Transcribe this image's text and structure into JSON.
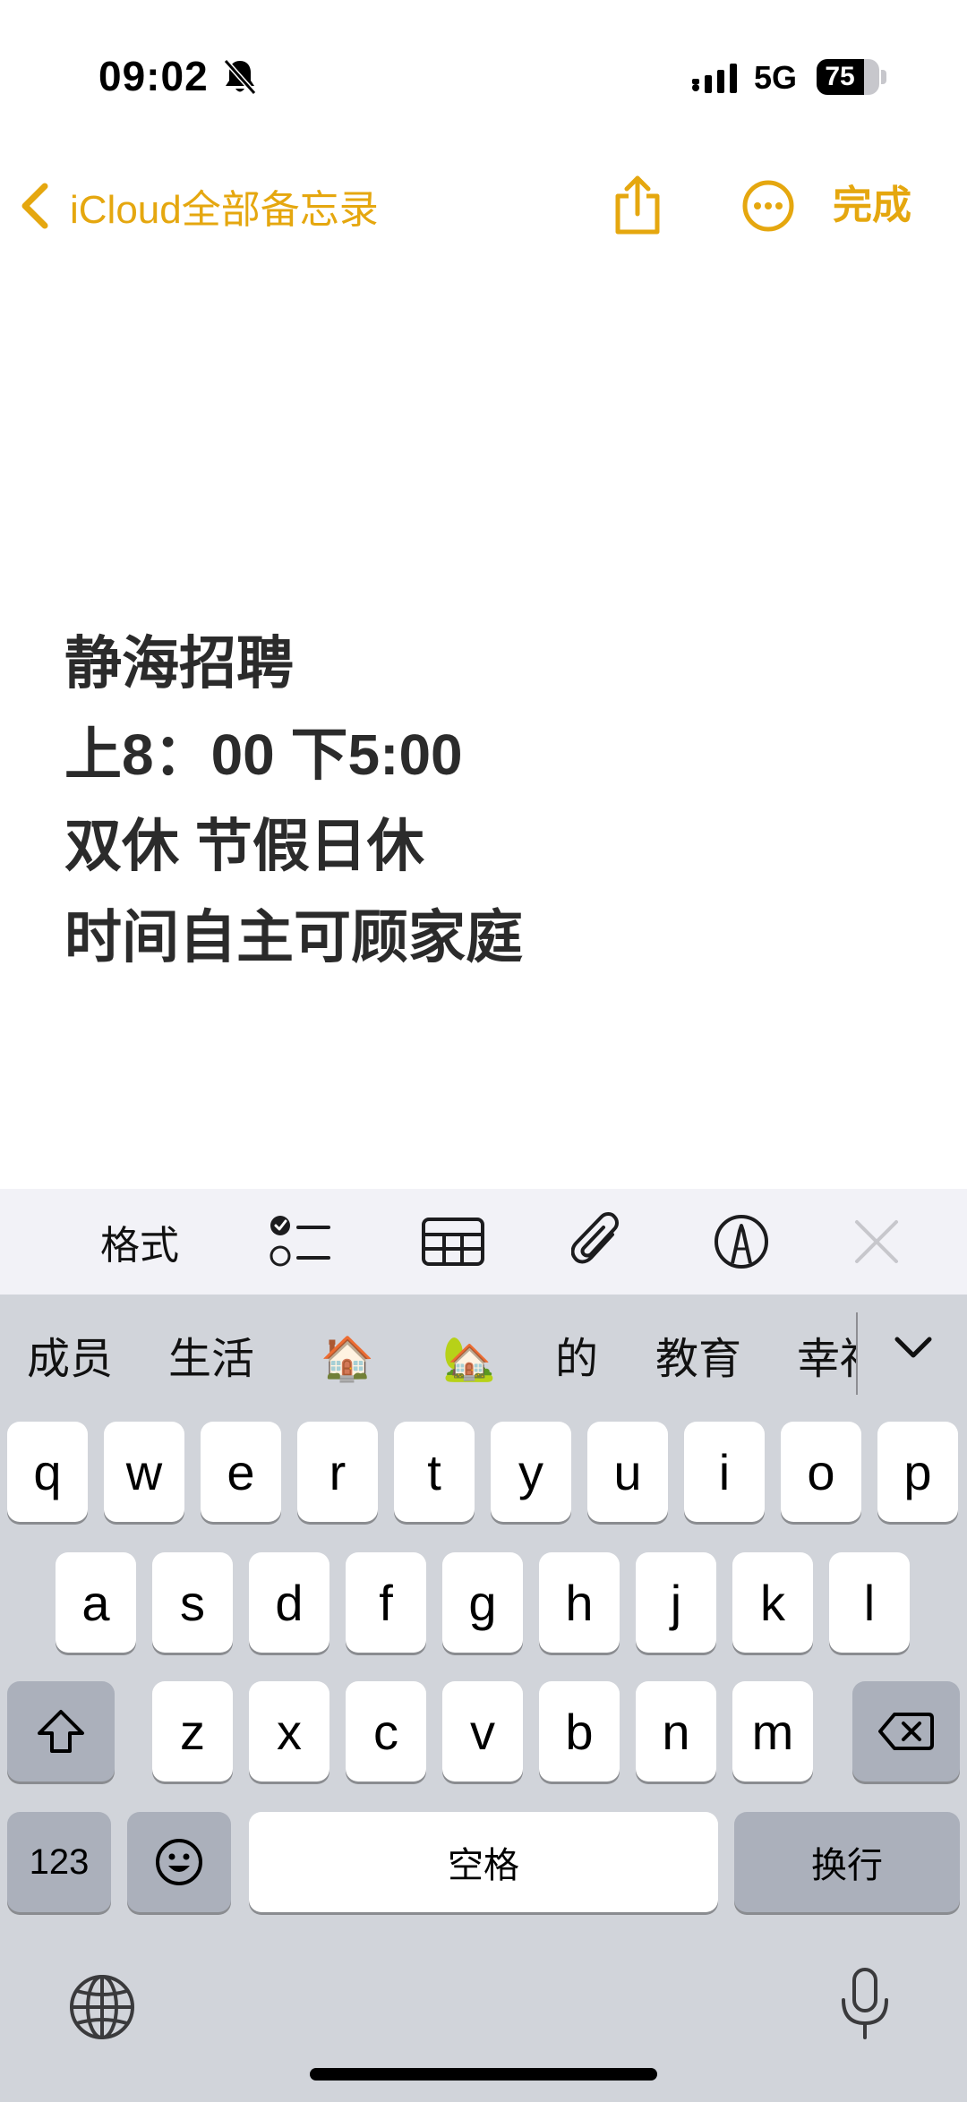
{
  "status_bar": {
    "time": "09:02",
    "network": "5G",
    "battery_level": "75",
    "battery_fraction": 0.75
  },
  "nav": {
    "back_label": "iCloud全部备忘录",
    "done_label": "完成"
  },
  "note": {
    "lines": [
      "静海招聘",
      "上8：00 下5:00",
      "双休 节假日休",
      "时间自主可顾家庭"
    ]
  },
  "toolbar": {
    "format_label": "格式"
  },
  "keyboard": {
    "candidates": [
      "成员",
      "生活",
      "🏠",
      "🏡",
      "的",
      "教育",
      "幸福"
    ],
    "row1": [
      "q",
      "w",
      "e",
      "r",
      "t",
      "y",
      "u",
      "i",
      "o",
      "p"
    ],
    "row2": [
      "a",
      "s",
      "d",
      "f",
      "g",
      "h",
      "j",
      "k",
      "l"
    ],
    "row3": [
      "z",
      "x",
      "c",
      "v",
      "b",
      "n",
      "m"
    ],
    "numbers_label": "123",
    "space_label": "空格",
    "return_label": "换行"
  },
  "colors": {
    "accent": "#e5a70f",
    "keyboard_bg": "#d1d4da",
    "toolbar_bg": "#f2f2f7"
  },
  "icons": [
    "bell-slash-icon",
    "signal-icon",
    "chevron-left-icon",
    "share-icon",
    "more-icon",
    "checklist-icon",
    "table-icon",
    "paperclip-icon",
    "markup-icon",
    "close-icon",
    "chevron-down-icon",
    "shift-icon",
    "delete-icon",
    "emoji-icon",
    "globe-icon",
    "microphone-icon"
  ]
}
